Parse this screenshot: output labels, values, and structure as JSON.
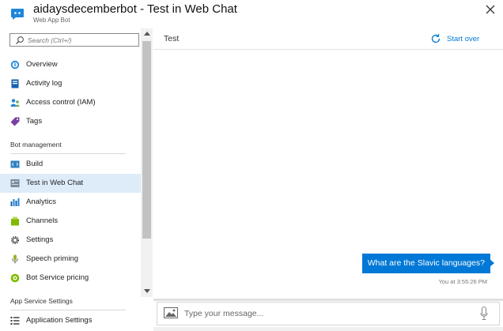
{
  "header": {
    "title": "aidaysdecemberbot - Test in Web Chat",
    "subtitle": "Web App Bot",
    "close_icon": "close-icon"
  },
  "sidebar": {
    "search_placeholder": "Search (Ctrl+/)",
    "collapse_glyph": "«",
    "items_top": [
      {
        "label": "Overview",
        "icon": "overview-icon"
      },
      {
        "label": "Activity log",
        "icon": "activity-log-icon"
      },
      {
        "label": "Access control (IAM)",
        "icon": "access-control-icon"
      },
      {
        "label": "Tags",
        "icon": "tag-icon"
      }
    ],
    "section_bot_management": "Bot management",
    "items_bot": [
      {
        "label": "Build",
        "icon": "build-icon"
      },
      {
        "label": "Test in Web Chat",
        "icon": "test-web-chat-icon",
        "selected": true
      },
      {
        "label": "Analytics",
        "icon": "analytics-icon"
      },
      {
        "label": "Channels",
        "icon": "channels-icon"
      },
      {
        "label": "Settings",
        "icon": "settings-icon"
      },
      {
        "label": "Speech priming",
        "icon": "speech-priming-icon"
      },
      {
        "label": "Bot Service pricing",
        "icon": "pricing-icon"
      }
    ],
    "section_app_service": "App Service Settings",
    "items_app": [
      {
        "label": "Application Settings",
        "icon": "application-settings-icon"
      }
    ]
  },
  "chat": {
    "title": "Test",
    "start_over_label": "Start over",
    "message": "What are the Slavic languages?",
    "timestamp": "You at 3:55:26 PM",
    "composer_placeholder": "Type your message..."
  },
  "colors": {
    "accent": "#0078d7",
    "selected_bg": "#deecf9"
  }
}
